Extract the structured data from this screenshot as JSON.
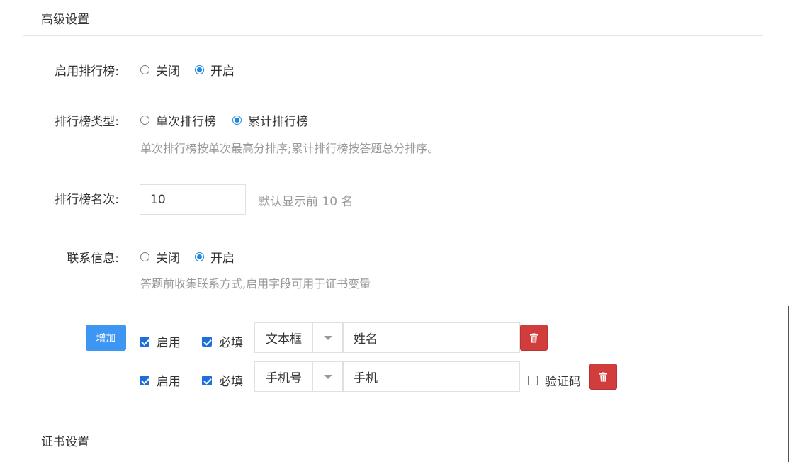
{
  "advanced": {
    "title": "高级设置",
    "ranking_enable": {
      "label": "启用排行榜:",
      "options": [
        "关闭",
        "开启"
      ],
      "selected": "开启"
    },
    "ranking_type": {
      "label": "排行榜类型:",
      "options": [
        "单次排行榜",
        "累计排行榜"
      ],
      "selected": "累计排行榜",
      "hint": "单次排行榜按单次最高分排序;累计排行榜按答题总分排序。"
    },
    "ranking_count": {
      "label": "排行榜名次:",
      "value": "10",
      "hint": "默认显示前 10 名"
    },
    "contact": {
      "label": "联系信息:",
      "options": [
        "关闭",
        "开启"
      ],
      "selected": "开启",
      "hint": "答题前收集联系方式,启用字段可用于证书变量"
    },
    "add_button": "增加",
    "fields": [
      {
        "enabled_label": "启用",
        "enabled": true,
        "required_label": "必填",
        "required": true,
        "type": "文本框",
        "name": "姓名",
        "delete_icon": "trash-icon"
      },
      {
        "enabled_label": "启用",
        "enabled": true,
        "required_label": "必填",
        "required": true,
        "type": "手机号",
        "name": "手机",
        "verify_label": "验证码",
        "verify": false,
        "delete_icon": "trash-icon"
      }
    ]
  },
  "certificate": {
    "title": "证书设置"
  },
  "colors": {
    "primary": "#1e88e5",
    "add_button": "#3d96f2",
    "delete_button": "#d13d3d",
    "hint": "#999999"
  }
}
